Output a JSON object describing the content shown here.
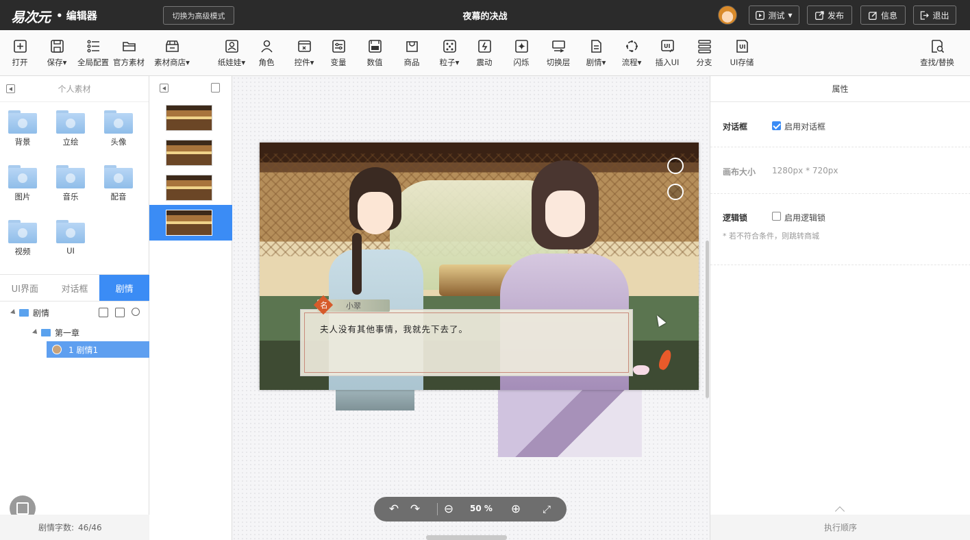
{
  "header": {
    "logo": "易次元",
    "subtitle": "• 编辑器",
    "mode_button": "切换为高级模式",
    "project_title": "夜幕的决战",
    "buttons": [
      {
        "label": "测试",
        "icon": "play-icon"
      },
      {
        "label": "发布",
        "icon": "share-icon"
      },
      {
        "label": "信息",
        "icon": "edit-icon"
      },
      {
        "label": "退出",
        "icon": "exit-icon"
      }
    ]
  },
  "toolbar": {
    "items": [
      {
        "label": "打开",
        "icon": "plus-icon"
      },
      {
        "label": "保存▾",
        "icon": "save-icon"
      },
      {
        "label": "全局配置",
        "icon": "list-icon"
      },
      {
        "label": "官方素材",
        "icon": "folder-icon"
      },
      {
        "label": "素材商店▾",
        "icon": "store-icon"
      },
      {
        "label": "纸娃娃▾",
        "icon": "doll-icon"
      },
      {
        "label": "角色",
        "icon": "person-icon"
      },
      {
        "label": "控件▾",
        "icon": "widget-icon"
      },
      {
        "label": "变量",
        "icon": "variable-icon"
      },
      {
        "label": "数值",
        "icon": "number-icon"
      },
      {
        "label": "商品",
        "icon": "bag-icon"
      },
      {
        "label": "粒子▾",
        "icon": "particle-icon"
      },
      {
        "label": "震动",
        "icon": "shake-icon"
      },
      {
        "label": "闪烁",
        "icon": "flash-icon"
      },
      {
        "label": "切换层",
        "icon": "layer-icon"
      },
      {
        "label": "剧情▾",
        "icon": "story-icon"
      },
      {
        "label": "流程▾",
        "icon": "flow-icon"
      },
      {
        "label": "插入UI",
        "icon": "insert-ui-icon"
      },
      {
        "label": "分支",
        "icon": "branch-icon"
      },
      {
        "label": "UI存储",
        "icon": "ui-save-icon"
      },
      {
        "label": "查找/替换",
        "icon": "find-replace-icon"
      }
    ]
  },
  "left_panel": {
    "title": "个人素材",
    "folders": [
      "背景",
      "立绘",
      "头像",
      "图片",
      "音乐",
      "配音",
      "视频",
      "UI"
    ],
    "tabs": [
      "UI界面",
      "对话框",
      "剧情"
    ],
    "active_tab": "剧情",
    "tree": {
      "root": "剧情",
      "chapter": "第一章",
      "story": "1  剧情1"
    },
    "footer_label": "剧情字数:",
    "footer_value": "46/46"
  },
  "stage": {
    "speaker_badge": "名",
    "speaker_name": "小翠",
    "dialog_text": "夫人没有其他事情，我就先下去了。"
  },
  "zoom": {
    "value": "50 %"
  },
  "right_panel": {
    "title": "属性",
    "dialog_box_label": "对话框",
    "dialog_box_check": "启用对话框",
    "dialog_box_enabled": true,
    "canvas_size_label": "画布大小",
    "canvas_size_value": "1280px * 720px",
    "logic_lock_label": "逻辑锁",
    "logic_lock_check": "启用逻辑锁",
    "logic_lock_enabled": false,
    "logic_lock_note": "* 若不符合条件，则跳转商城",
    "footer": "执行顺序"
  },
  "colors": {
    "accent": "#3b8cf5",
    "topbar": "#2b2b2b"
  }
}
